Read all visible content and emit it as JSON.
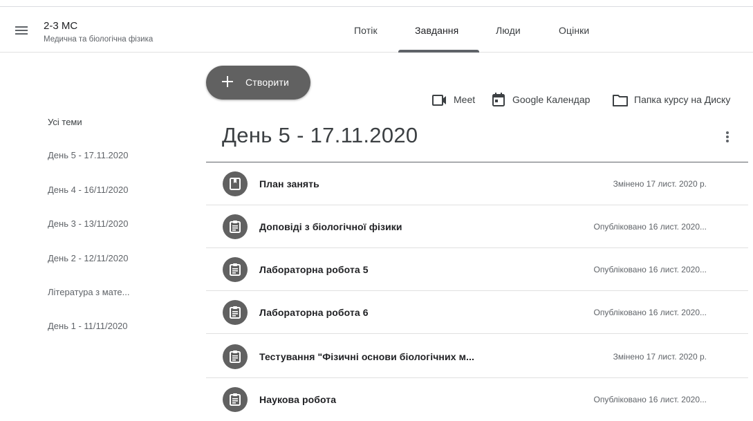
{
  "class": {
    "title": "2-3 МС",
    "subtitle": "Медична та біологічна фізика"
  },
  "tabs": [
    {
      "label": "Потік"
    },
    {
      "label": "Завдання",
      "active": true
    },
    {
      "label": "Люди"
    },
    {
      "label": "Оцінки"
    }
  ],
  "toolbar": {
    "create_label": "Створити",
    "meet_label": "Meet",
    "calendar_label": "Google Календар",
    "drive_label": "Папка курсу на Диску"
  },
  "sidebar": {
    "items": [
      {
        "label": "Усі теми"
      },
      {
        "label": "День 5 - 17.11.2020"
      },
      {
        "label": "День 4 - 16/11/2020"
      },
      {
        "label": "День 3 - 13/11/2020"
      },
      {
        "label": "День 2 - 12/11/2020"
      },
      {
        "label": "Література з мате..."
      },
      {
        "label": "День 1 - 11/11/2020"
      }
    ]
  },
  "topic": {
    "title": "День 5 - 17.11.2020",
    "items": [
      {
        "icon": "material-icon",
        "title": "План занять",
        "date": "Змінено 17 лист. 2020 р."
      },
      {
        "icon": "assignment-icon",
        "title": "Доповіді з біологічної фізики",
        "date": "Опубліковано 16 лист. 2020..."
      },
      {
        "icon": "assignment-icon",
        "title": "Лабораторна робота 5",
        "date": "Опубліковано 16 лист. 2020..."
      },
      {
        "icon": "assignment-icon",
        "title": "Лабораторна робота 6",
        "date": "Опубліковано 16 лист. 2020..."
      },
      {
        "icon": "assignment-icon",
        "title": "Тестування \"Фізичні основи біологічних м...",
        "date": "Змінено 17 лист. 2020 р."
      },
      {
        "icon": "assignment-icon",
        "title": "Наукова робота",
        "date": "Опубліковано 16 лист. 2020..."
      }
    ]
  },
  "colors": {
    "accent": "#616161",
    "text": "#3c4043",
    "secondary_text": "#5f6368",
    "divider": "#e0e0e0"
  }
}
